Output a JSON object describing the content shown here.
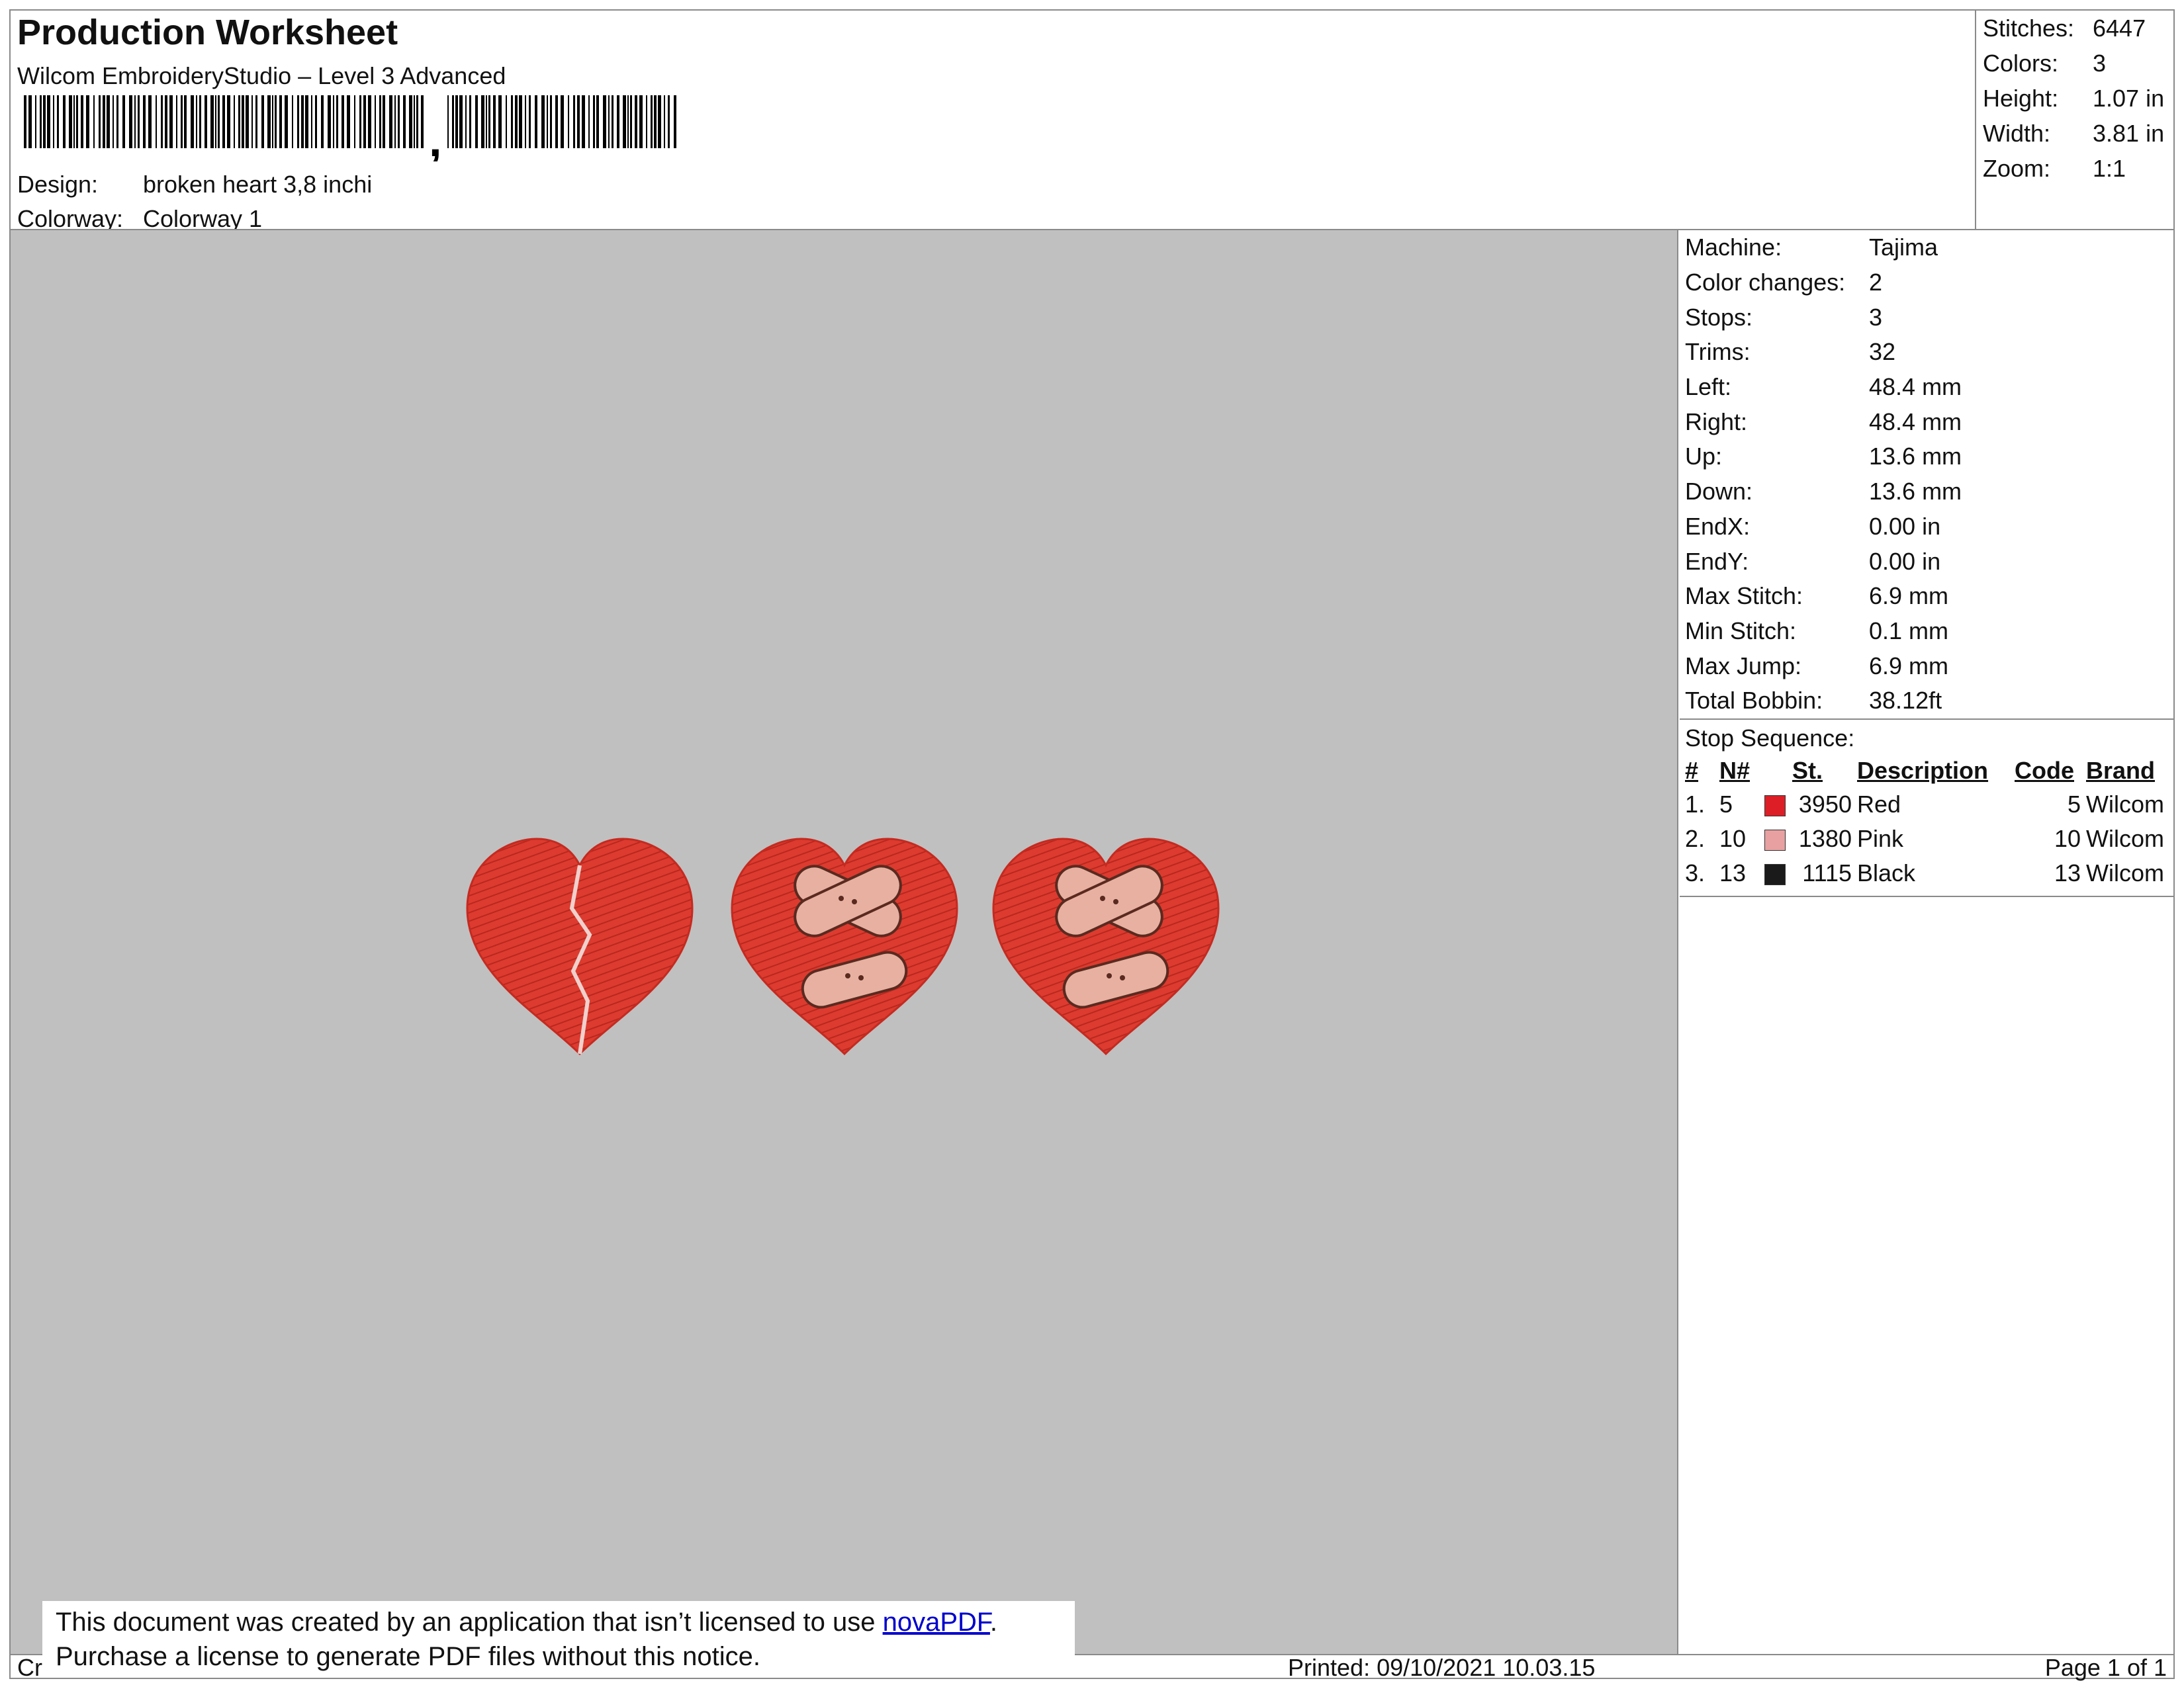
{
  "header": {
    "title": "Production Worksheet",
    "subtitle": "Wilcom EmbroideryStudio – Level 3 Advanced",
    "barcode_suffix": ",",
    "design_label": "Design:",
    "design_value": "broken heart 3,8 inchi",
    "colorway_label": "Colorway:",
    "colorway_value": "Colorway 1"
  },
  "stats": [
    {
      "label": "Stitches:",
      "value": "6447"
    },
    {
      "label": "Colors:",
      "value": "3"
    },
    {
      "label": "Height:",
      "value": "1.07 in"
    },
    {
      "label": "Width:",
      "value": "3.81 in"
    },
    {
      "label": "Zoom:",
      "value": "1:1"
    }
  ],
  "machine_info": [
    {
      "label": "Machine:",
      "value": "Tajima"
    },
    {
      "label": "Color changes:",
      "value": "2"
    },
    {
      "label": "Stops:",
      "value": "3"
    },
    {
      "label": "Trims:",
      "value": "32"
    },
    {
      "label": "Left:",
      "value": "48.4 mm"
    },
    {
      "label": "Right:",
      "value": "48.4 mm"
    },
    {
      "label": "Up:",
      "value": "13.6 mm"
    },
    {
      "label": "Down:",
      "value": "13.6 mm"
    },
    {
      "label": "EndX:",
      "value": "0.00 in"
    },
    {
      "label": "EndY:",
      "value": "0.00 in"
    },
    {
      "label": "Max Stitch:",
      "value": "6.9 mm"
    },
    {
      "label": "Min Stitch:",
      "value": "0.1 mm"
    },
    {
      "label": "Max Jump:",
      "value": "6.9 mm"
    },
    {
      "label": "Total Bobbin:",
      "value": "38.12ft"
    }
  ],
  "stop_sequence": {
    "title": "Stop Sequence:",
    "headers": [
      "#",
      "N#",
      "St.",
      "Description",
      "Code",
      "Brand"
    ],
    "rows": [
      {
        "idx": "1.",
        "n": "5",
        "color": "#dd1e26",
        "st": "3950",
        "desc": "Red",
        "code": "5",
        "brand": "Wilcom"
      },
      {
        "idx": "2.",
        "n": "10",
        "color": "#e8a0a0",
        "st": "1380",
        "desc": "Pink",
        "code": "10",
        "brand": "Wilcom"
      },
      {
        "idx": "3.",
        "n": "13",
        "color": "#1a1a1a",
        "st": "1115",
        "desc": "Black",
        "code": "13",
        "brand": "Wilcom"
      }
    ]
  },
  "footer": {
    "left": "Cr",
    "printed": "Printed: 09/10/2021 10.03.15",
    "page": "Page 1 of 1"
  },
  "notice": {
    "line1_text": "This document was created by an application that isn’t licensed to use ",
    "link": "novaPDF",
    "line1_end": ".",
    "line2": "Purchase a license to generate PDF files without this notice."
  },
  "colors": {
    "canvas": "#c0c0c0",
    "heart_red": "#dd3b2f",
    "bandage": "#e8b0a0"
  }
}
